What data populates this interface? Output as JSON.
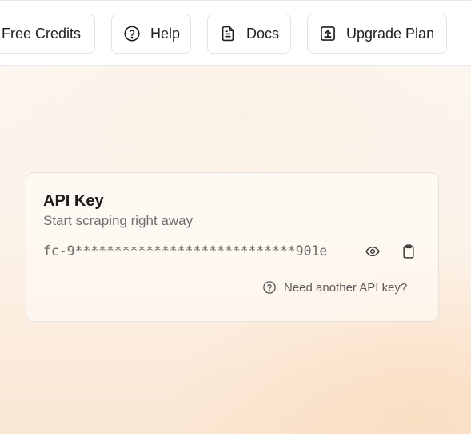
{
  "header": {
    "buttons": [
      {
        "label": "Free Credits",
        "icon": "gift-icon"
      },
      {
        "label": "Help",
        "icon": "question-circle-icon"
      },
      {
        "label": "Docs",
        "icon": "document-icon"
      },
      {
        "label": "Upgrade Plan",
        "icon": "upload-box-icon"
      }
    ]
  },
  "api_card": {
    "title": "API Key",
    "subtitle": "Start scraping right away",
    "key_masked": "fc-9****************************901e",
    "reveal_icon": "eye-icon",
    "copy_icon": "clipboard-icon",
    "help_link": "Need another API key?",
    "help_icon": "question-circle-icon"
  }
}
